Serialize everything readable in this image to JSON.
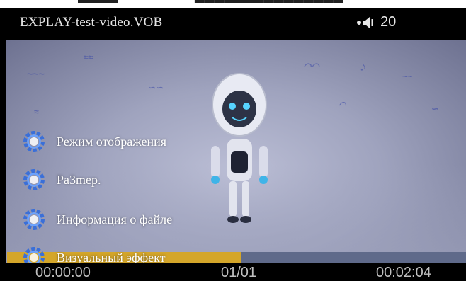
{
  "header": {
    "file_title": "EXPLAY-test-video.VOB",
    "volume_icon": "speaker-icon",
    "volume_level": "20"
  },
  "menu": {
    "icon": "gear-icon",
    "items": [
      {
        "label": "Режим отображения"
      },
      {
        "label": "Ра3mер."
      },
      {
        "label": "Информация о файле"
      },
      {
        "label": "Визуальный эффект"
      }
    ]
  },
  "playback": {
    "elapsed": "00:00:00",
    "track_counter": "01/01",
    "total": "00:02:04",
    "progress_fraction": 0.51
  },
  "colors": {
    "progress_fill": "#d4a62a",
    "progress_track": "#5f6a8a",
    "gear": "#3a6fd8"
  }
}
